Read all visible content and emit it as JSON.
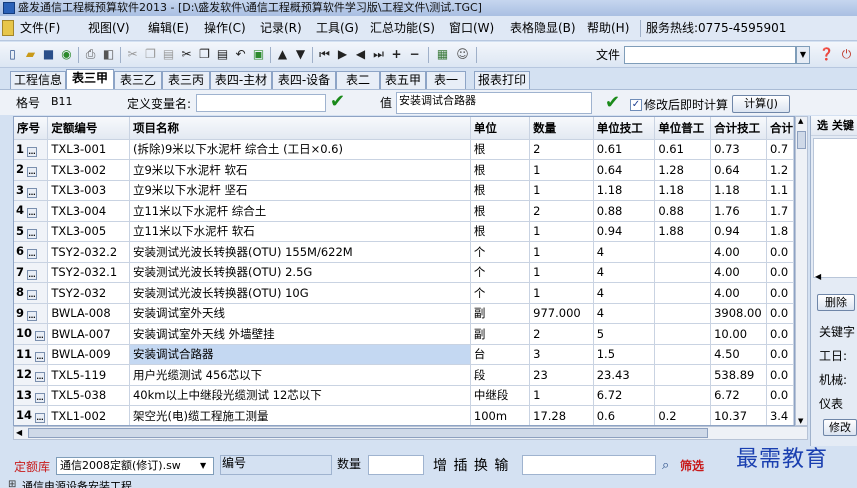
{
  "window": {
    "title": "盛发通信工程概预算软件2013 - [D:\\盛发软件\\通信工程概预算软件学习版\\工程文件\\测试.TGC]"
  },
  "menu": [
    {
      "label": "文件(F)"
    },
    {
      "label": "视图(V)"
    },
    {
      "label": "编辑(E)"
    },
    {
      "label": "操作(C)"
    },
    {
      "label": "记录(R)"
    },
    {
      "label": "工具(G)"
    },
    {
      "label": "汇总功能(S)"
    },
    {
      "label": "窗口(W)"
    },
    {
      "label": "表格隐显(B)"
    },
    {
      "label": "帮助(H)"
    },
    {
      "label": "服务热线:0775-4595901"
    }
  ],
  "toolbar": {
    "icons": [
      "new-icon",
      "open-icon",
      "save-icon",
      "refresh-icon",
      "print-icon",
      "preview-icon",
      "cut-icon",
      "copy-icon",
      "paste-icon",
      "undo-icon",
      "calc-icon",
      "up-icon",
      "down-icon",
      "first-icon",
      "prev-icon",
      "next-icon",
      "last-icon",
      "add-icon",
      "delete-icon",
      "grid-icon",
      "user-icon"
    ],
    "file_label": "文件",
    "file_value": ""
  },
  "tabs": [
    {
      "label": "工程信息"
    },
    {
      "label": "表三甲",
      "active": true
    },
    {
      "label": "表三乙"
    },
    {
      "label": "表三丙"
    },
    {
      "label": "表四-主材"
    },
    {
      "label": "表四-设备"
    },
    {
      "label": "表二"
    },
    {
      "label": "表五甲"
    },
    {
      "label": "表一"
    },
    {
      "label": "报表打印"
    }
  ],
  "editrow": {
    "code_label": "格号",
    "code_value": "B11",
    "var_label": "定义变量名:",
    "var_value": "",
    "value_label": "值",
    "value_value": "安装调试合路器",
    "recalc_label": "修改后即时计算",
    "recalc_checked": true,
    "calc_button": "计算(J)"
  },
  "grid": {
    "headers": [
      "序号",
      "定额编号",
      "项目名称",
      "单位",
      "数量",
      "单位技工",
      "单位普工",
      "合计技工",
      "合计"
    ],
    "rows": [
      {
        "no": "1",
        "code": "TXL3-001",
        "name": "(拆除)9米以下水泥杆 综合土 (工日×0.6)",
        "unit": "根",
        "qty": "2",
        "ut": "0.61",
        "up": "0.61",
        "tt": "0.73",
        "tp": "0.7"
      },
      {
        "no": "2",
        "code": "TXL3-002",
        "name": "立9米以下水泥杆 软石",
        "unit": "根",
        "qty": "1",
        "ut": "0.64",
        "up": "1.28",
        "tt": "0.64",
        "tp": "1.2"
      },
      {
        "no": "3",
        "code": "TXL3-003",
        "name": "立9米以下水泥杆 坚石",
        "unit": "根",
        "qty": "1",
        "ut": "1.18",
        "up": "1.18",
        "tt": "1.18",
        "tp": "1.1"
      },
      {
        "no": "4",
        "code": "TXL3-004",
        "name": "立11米以下水泥杆 综合土",
        "unit": "根",
        "qty": "2",
        "ut": "0.88",
        "up": "0.88",
        "tt": "1.76",
        "tp": "1.7"
      },
      {
        "no": "5",
        "code": "TXL3-005",
        "name": "立11米以下水泥杆 软石",
        "unit": "根",
        "qty": "1",
        "ut": "0.94",
        "up": "1.88",
        "tt": "0.94",
        "tp": "1.8"
      },
      {
        "no": "6",
        "code": "TSY2-032.2",
        "name": "安装测试光波长转换器(OTU) 155M/622M",
        "unit": "个",
        "qty": "1",
        "ut": "4",
        "up": "",
        "tt": "4.00",
        "tp": "0.0"
      },
      {
        "no": "7",
        "code": "TSY2-032.1",
        "name": "安装测试光波长转换器(OTU) 2.5G",
        "unit": "个",
        "qty": "1",
        "ut": "4",
        "up": "",
        "tt": "4.00",
        "tp": "0.0"
      },
      {
        "no": "8",
        "code": "TSY2-032",
        "name": "安装测试光波长转换器(OTU) 10G",
        "unit": "个",
        "qty": "1",
        "ut": "4",
        "up": "",
        "tt": "4.00",
        "tp": "0.0"
      },
      {
        "no": "9",
        "code": "BWLA-008",
        "name": "安装调试室外天线",
        "unit": "副",
        "qty": "977.000",
        "ut": "4",
        "up": "",
        "tt": "3908.00",
        "tp": "0.0"
      },
      {
        "no": "10",
        "code": "BWLA-007",
        "name": "安装调试室外天线 外墙壁挂",
        "unit": "副",
        "qty": "2",
        "ut": "5",
        "up": "",
        "tt": "10.00",
        "tp": "0.0"
      },
      {
        "no": "11",
        "code": "BWLA-009",
        "name": "安装调试合路器",
        "unit": "台",
        "qty": "3",
        "ut": "1.5",
        "up": "",
        "tt": "4.50",
        "tp": "0.0",
        "selected": true
      },
      {
        "no": "12",
        "code": "TXL5-119",
        "name": "用户光缆测试 456芯以下",
        "unit": "段",
        "qty": "23",
        "ut": "23.43",
        "up": "",
        "tt": "538.89",
        "tp": "0.0"
      },
      {
        "no": "13",
        "code": "TXL5-038",
        "name": "40km以上中继段光缆测试 12芯以下",
        "unit": "中继段",
        "qty": "1",
        "ut": "6.72",
        "up": "",
        "tt": "6.72",
        "tp": "0.0"
      },
      {
        "no": "14",
        "code": "TXL1-002",
        "name": "架空光(电)缆工程施工测量",
        "unit": "100m",
        "qty": "17.28",
        "ut": "0.6",
        "up": "0.2",
        "tt": "10.37",
        "tp": "3.4"
      }
    ]
  },
  "rightpanel": {
    "head1": "选",
    "head2": "关键",
    "delete_btn": "删除",
    "keyword_label": "关键字",
    "worker_label": "工日:",
    "machine_label": "机械:",
    "meter_label": "仪表",
    "modify_btn": "修改"
  },
  "bottom": {
    "lib_label": "定额库",
    "lib_value": "通信2008定额(修订).sw",
    "tree_item": "通信电源设备安装工程",
    "code_label": "编号",
    "qty_label": "数量",
    "actions": "增 插 换 输",
    "filter_label": "筛选",
    "watermark": "最需教育"
  },
  "colors": {
    "selected_row": "#c4d8f2",
    "check": "#1a8a1a",
    "accent": "#2a61b8"
  }
}
